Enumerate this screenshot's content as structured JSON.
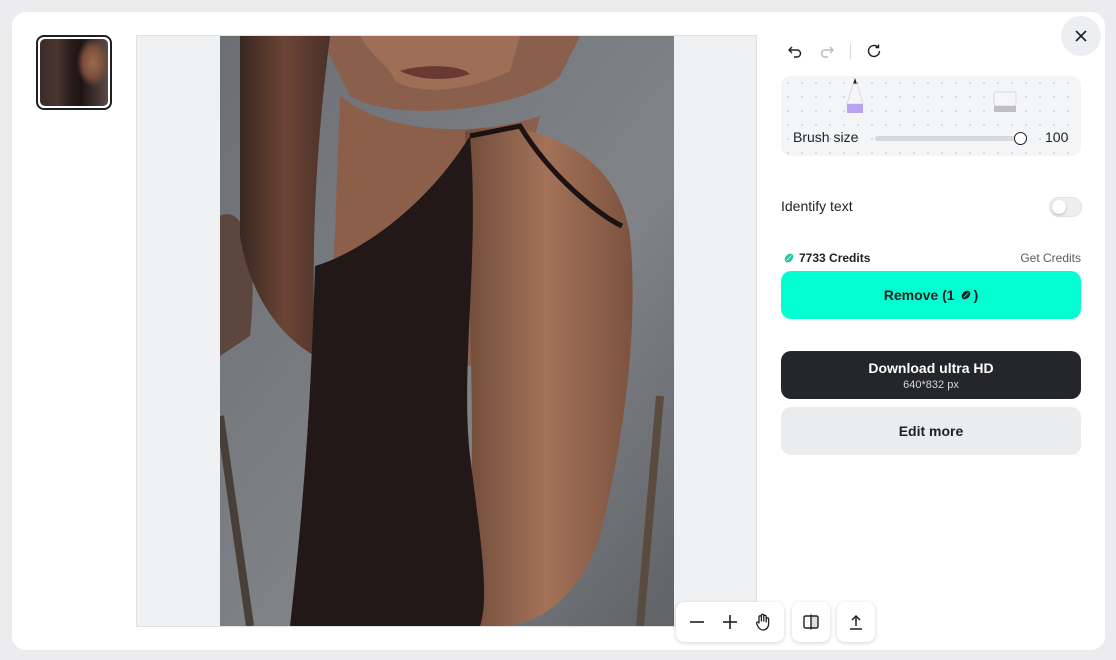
{
  "brush": {
    "label": "Brush size",
    "value": "100"
  },
  "identify_text": {
    "label": "Identify text",
    "enabled": false
  },
  "credits": {
    "amount_text": "7733 Credits",
    "get_label": "Get Credits"
  },
  "remove_button": {
    "label": "Remove (1",
    "suffix": ")"
  },
  "download": {
    "title": "Download ultra HD",
    "resolution": "640*832 px"
  },
  "edit_more": {
    "label": "Edit more"
  },
  "icons": {
    "close": "close-icon",
    "undo": "undo-icon",
    "redo": "redo-icon",
    "refresh": "refresh-icon",
    "pen": "pen-icon",
    "eraser": "eraser-icon",
    "credit": "credit-bean-icon",
    "zoom_out": "zoom-out-icon",
    "zoom_in": "zoom-in-icon",
    "hand": "hand-icon",
    "compare": "compare-icon",
    "upload": "upload-icon"
  },
  "colors": {
    "accent": "#03ffd1",
    "dark_button": "#25262b",
    "credit_icon": "#1fc7a0",
    "pen_purple": "#b9a3f2"
  }
}
